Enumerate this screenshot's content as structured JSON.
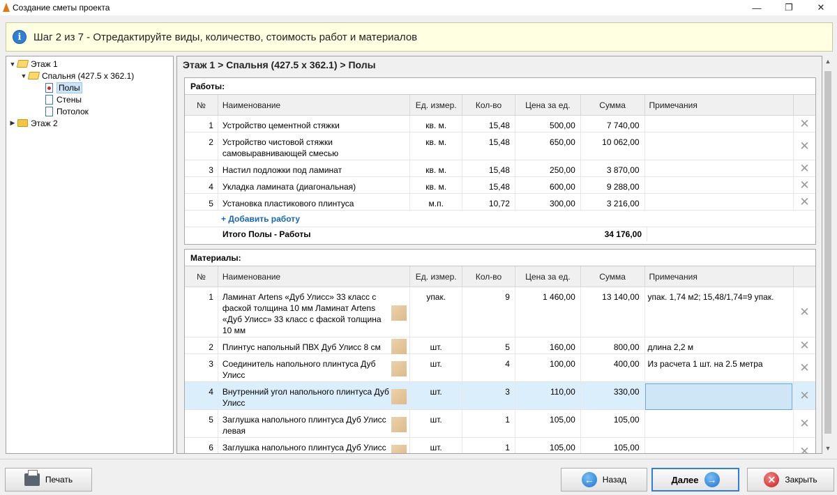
{
  "window": {
    "title": "Создание сметы проекта"
  },
  "banner": {
    "text": "Шаг 2 из 7 - Отредактируйте виды, количество, стоимость работ и материалов"
  },
  "tree": {
    "floor1": "Этаж 1",
    "room": "Спальня (427.5 x 362.1)",
    "floors": "Полы",
    "walls": "Стены",
    "ceiling": "Потолок",
    "floor2": "Этаж 2"
  },
  "breadcrumb": "Этаж 1 > Спальня (427.5 x 362.1) > Полы",
  "columns": {
    "no": "№",
    "name": "Наименование",
    "unit": "Ед. измер.",
    "qty": "Кол-во",
    "price": "Цена за ед.",
    "sum": "Сумма",
    "note": "Примечания"
  },
  "works": {
    "title": "Работы:",
    "rows": [
      {
        "no": "1",
        "name": "Устройство цементной стяжки",
        "unit": "кв. м.",
        "qty": "15,48",
        "price": "500,00",
        "sum": "7 740,00",
        "note": ""
      },
      {
        "no": "2",
        "name": "Устройство чистовой стяжки самовыравнивающей смесью",
        "unit": "кв. м.",
        "qty": "15,48",
        "price": "650,00",
        "sum": "10 062,00",
        "note": ""
      },
      {
        "no": "3",
        "name": "Настил подложки под ламинат",
        "unit": "кв. м.",
        "qty": "15,48",
        "price": "250,00",
        "sum": "3 870,00",
        "note": ""
      },
      {
        "no": "4",
        "name": "Укладка ламината (диагональная)",
        "unit": "кв. м.",
        "qty": "15,48",
        "price": "600,00",
        "sum": "9 288,00",
        "note": ""
      },
      {
        "no": "5",
        "name": "Установка пластикового плинтуса",
        "unit": "м.п.",
        "qty": "10,72",
        "price": "300,00",
        "sum": "3 216,00",
        "note": ""
      }
    ],
    "add_label": "+ Добавить работу",
    "total_label": "Итого Полы - Работы",
    "total_value": "34 176,00"
  },
  "materials": {
    "title": "Материалы:",
    "rows": [
      {
        "no": "1",
        "name": "Ламинат Artens «Дуб Улисс» 33 класс с фаской толщина 10 мм Ламинат Artens «Дуб Улисс» 33 класс с фаской толщина 10 мм",
        "unit": "упак.",
        "qty": "9",
        "price": "1 460,00",
        "sum": "13 140,00",
        "note": "упак. 1,74 м2; 15,48/1,74=9 упак."
      },
      {
        "no": "2",
        "name": "Плинтус напольный ПВХ Дуб Улисс 8 см",
        "unit": "шт.",
        "qty": "5",
        "price": "160,00",
        "sum": "800,00",
        "note": "длина 2,2 м"
      },
      {
        "no": "3",
        "name": "Соединитель напольного плинтуса Дуб Улисс",
        "unit": "шт.",
        "qty": "4",
        "price": "100,00",
        "sum": "400,00",
        "note": "Из расчета 1 шт. на 2.5 метра"
      },
      {
        "no": "4",
        "name": "Внутренний угол напольного плинтуса Дуб Улисс",
        "unit": "шт.",
        "qty": "3",
        "price": "110,00",
        "sum": "330,00",
        "note": ""
      },
      {
        "no": "5",
        "name": "Заглушка напольного плинтуса Дуб Улисс левая",
        "unit": "шт.",
        "qty": "1",
        "price": "105,00",
        "sum": "105,00",
        "note": ""
      },
      {
        "no": "6",
        "name": "Заглушка напольного плинтуса Дуб Улисс",
        "unit": "шт.",
        "qty": "1",
        "price": "105,00",
        "sum": "105,00",
        "note": ""
      }
    ]
  },
  "buttons": {
    "print": "Печать",
    "back": "Назад",
    "next": "Далее",
    "close": "Закрыть"
  },
  "colors": {
    "accent": "#2f7fd6",
    "selected_row": "#dbeefb",
    "link": "#1566c0"
  }
}
